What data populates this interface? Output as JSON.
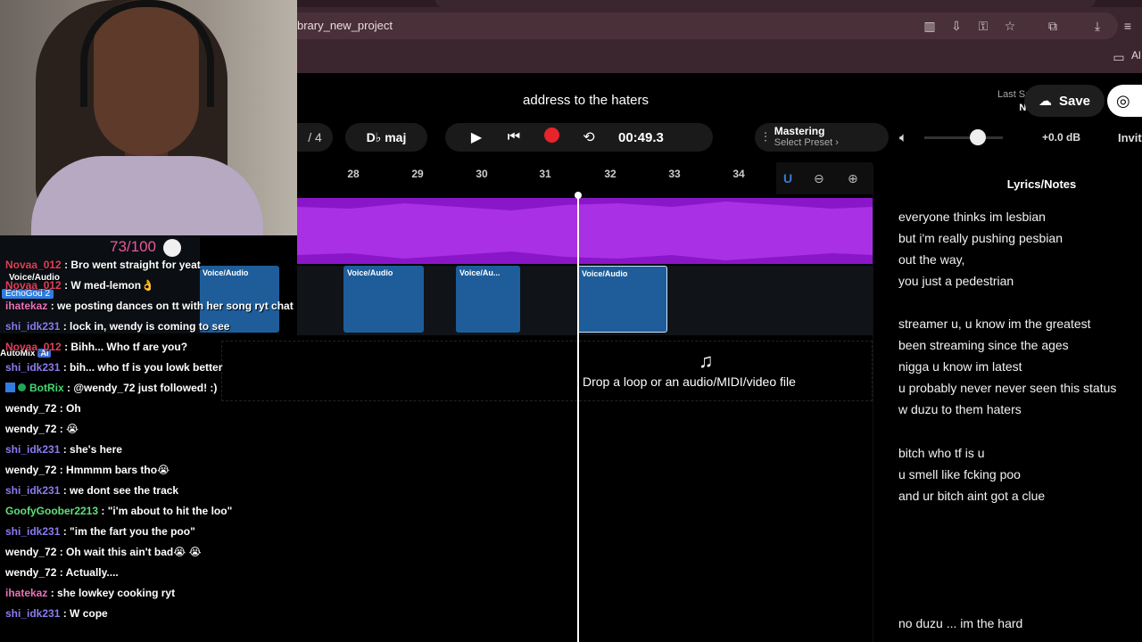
{
  "browser": {
    "url": "brary_new_project",
    "bookmarks_label": "Al"
  },
  "header": {
    "project_title": "address to the haters",
    "last_saved_label": "Last Saved",
    "last_saved_value": "Never",
    "save_label": "Save",
    "meter": "/ 4",
    "key": "D♭ maj",
    "time": "00:49.3",
    "mastering_title": "Mastering",
    "mastering_preset": "Select Preset ›",
    "volume_db": "+0.0 dB",
    "invite_label": "Invit",
    "volume_level": 0.6
  },
  "ruler": {
    "ticks": [
      "28",
      "29",
      "30",
      "31",
      "32",
      "33",
      "34"
    ]
  },
  "tracks": {
    "clips": [
      {
        "label": "Voice/Audio"
      },
      {
        "label": "Voice/Audio"
      },
      {
        "label": "Voice/Au..."
      },
      {
        "label": "Voice/Audio"
      }
    ],
    "drop_text": "Drop a loop or an audio/MIDI/video file"
  },
  "lyrics": {
    "title": "Lyrics/Notes",
    "lines": [
      "everyone thinks im lesbian",
      "but i'm really pushing pesbian",
      "out the way,",
      "you just a pedestrian",
      "streamer u, u know im the greatest",
      "been streaming since the ages",
      "nigga u know im latest",
      "u probably never never seen this status",
      "w duzu to them haters",
      "bitch who tf is u",
      "u smell like fcking poo",
      "and ur bitch aint got a clue",
      "no duzu ... im the hard"
    ]
  },
  "overlay": {
    "score": "73/100",
    "mixer_track": "Voice/Audio",
    "echo_badge": "EchoGod 2",
    "automix": "AutoMix",
    "ai": "AI"
  },
  "chat": [
    {
      "user": "Novaa_012",
      "color": "#e0405a",
      "text": ": Bro went straight for yeat"
    },
    {
      "user": "Novaa_012",
      "color": "#e0405a",
      "text": ": W med-lemon👌"
    },
    {
      "user": "ihatekaz",
      "color": "#e873b8",
      "text": ": we posting dances on tt with her song ryt chat"
    },
    {
      "user": "shi_idk231",
      "color": "#8a7cf0",
      "text": ": lock in, wendy is coming to see"
    },
    {
      "user": "Novaa_012",
      "color": "#e0405a",
      "text": ": Bihh... Who tf are you?"
    },
    {
      "user": "shi_idk231",
      "color": "#8a7cf0",
      "text": ": bih... who tf is you lowk better"
    },
    {
      "user": "BotRix",
      "color": "#44d96e",
      "text": ": @wendy_72 just followed! :)"
    },
    {
      "user": "wendy_72",
      "color": "#ffffff",
      "text": ": Oh"
    },
    {
      "user": "wendy_72",
      "color": "#ffffff",
      "text": ": 😭"
    },
    {
      "user": "shi_idk231",
      "color": "#8a7cf0",
      "text": ": she's here"
    },
    {
      "user": "wendy_72",
      "color": "#ffffff",
      "text": ": Hmmmm bars tho😭"
    },
    {
      "user": "shi_idk231",
      "color": "#8a7cf0",
      "text": ": we dont see the track"
    },
    {
      "user": "GoofyGoober2213",
      "color": "#5fe07a",
      "text": ": \"i'm about to hit the loo\""
    },
    {
      "user": "shi_idk231",
      "color": "#8a7cf0",
      "text": ": \"im the fart you the poo\""
    },
    {
      "user": "wendy_72",
      "color": "#ffffff",
      "text": ": Oh wait this ain't bad😭 😭"
    },
    {
      "user": "wendy_72",
      "color": "#ffffff",
      "text": ": Actually...."
    },
    {
      "user": "ihatekaz",
      "color": "#e873b8",
      "text": ": she lowkey cooking ryt"
    },
    {
      "user": "shi_idk231",
      "color": "#8a7cf0",
      "text": ": W cope"
    }
  ]
}
